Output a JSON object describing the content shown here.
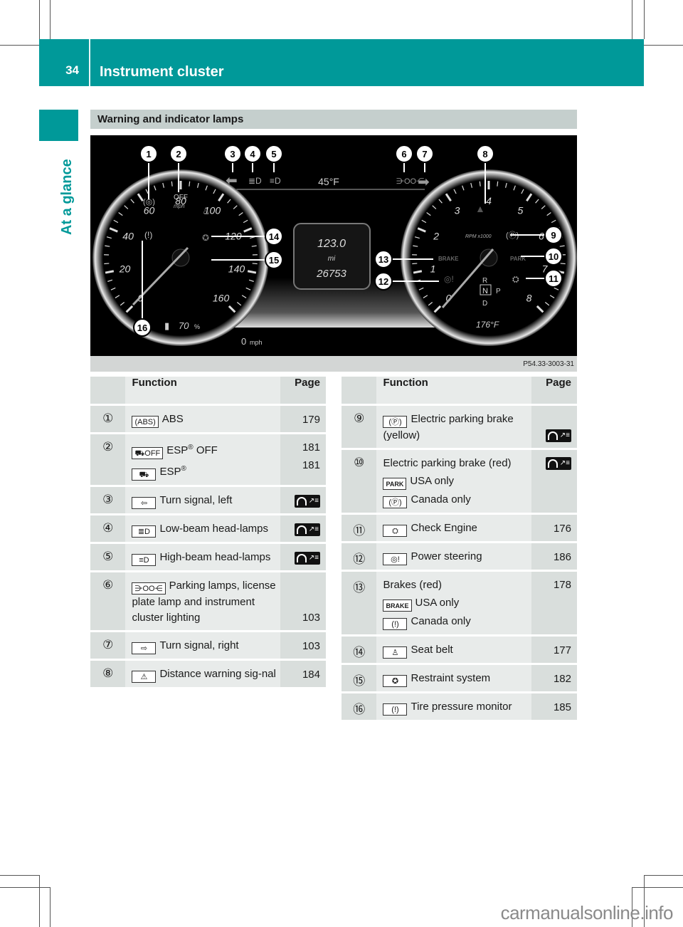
{
  "header": {
    "page_number": "34",
    "chapter_title": "Instrument cluster",
    "side_tab": "At a glance"
  },
  "section": {
    "title": "Warning and indicator lamps"
  },
  "figure": {
    "code": "P54.33-3003-31",
    "outside_temp": "45°F",
    "trip": "123.0",
    "unit": "mi",
    "odometer": "26753",
    "speed_readout": "0",
    "speed_unit": "mph",
    "fuel": "70",
    "fuel_unit": "%",
    "coolant": "176°F",
    "esp_off_label": "OFF",
    "mph_label": "mph",
    "rpm_label": "RPM x1000",
    "brake_label": "BRAKE",
    "park_label": "PARK",
    "gear_r": "R",
    "gear_n": "N",
    "gear_p": "P",
    "gear_d": "D",
    "speedo_ticks": [
      "0",
      "20",
      "40",
      "60",
      "80",
      "100",
      "120",
      "140",
      "160"
    ],
    "tacho_ticks": [
      "0",
      "1",
      "2",
      "3",
      "4",
      "5",
      "6",
      "7",
      "8"
    ],
    "callouts": [
      "1",
      "2",
      "3",
      "4",
      "5",
      "6",
      "7",
      "8",
      "9",
      "10",
      "11",
      "12",
      "13",
      "14",
      "15",
      "16"
    ]
  },
  "table_left": {
    "headers": {
      "function": "Function",
      "page": "Page"
    },
    "rows": [
      {
        "num": "1",
        "lines": [
          {
            "icon": "abs-icon",
            "icon_text": "(ABS)",
            "text": "ABS",
            "page": "179"
          }
        ]
      },
      {
        "num": "2",
        "lines": [
          {
            "icon": "esp-off-icon",
            "icon_text": "⛟OFF",
            "text": "ESP",
            "sup": "®",
            "text_after": " OFF",
            "page": "181"
          },
          {
            "icon": "esp-icon",
            "icon_text": "⛟",
            "text": "ESP",
            "sup": "®",
            "text_after": "",
            "page": "181"
          }
        ]
      },
      {
        "num": "3",
        "lines": [
          {
            "icon": "turn-left-icon",
            "icon_text": "⇦",
            "text": "Turn signal, left",
            "page_ref": "see-separate-manual-icon"
          }
        ]
      },
      {
        "num": "4",
        "lines": [
          {
            "icon": "low-beam-icon",
            "icon_text": "≣D",
            "text": "Low-beam head-lamps",
            "page_ref": "see-separate-manual-icon"
          }
        ]
      },
      {
        "num": "5",
        "lines": [
          {
            "icon": "high-beam-icon",
            "icon_text": "≡D",
            "text": "High-beam head-lamps",
            "page_ref": "see-separate-manual-icon"
          }
        ]
      },
      {
        "num": "6",
        "lines": [
          {
            "icon": "parking-lamps-icon",
            "icon_text": "⋺OO⋲",
            "text": "Parking lamps, license plate lamp and instrument cluster lighting",
            "page": "103"
          }
        ]
      },
      {
        "num": "7",
        "lines": [
          {
            "icon": "turn-right-icon",
            "icon_text": "⇨",
            "text": "Turn signal, right",
            "page": "103"
          }
        ]
      },
      {
        "num": "8",
        "lines": [
          {
            "icon": "distance-warning-icon",
            "icon_text": "⚠",
            "text": "Distance warning sig-nal",
            "page": "184"
          }
        ]
      }
    ]
  },
  "table_right": {
    "headers": {
      "function": "Function",
      "page": "Page"
    },
    "rows": [
      {
        "num": "9",
        "lines": [
          {
            "icon": "parking-brake-icon",
            "icon_text": "(Ⓟ)",
            "text": "Electric parking brake (yellow)",
            "page_ref": "see-separate-manual-icon"
          }
        ]
      },
      {
        "num": "10",
        "title": "Electric parking brake (red)",
        "page_ref": "see-separate-manual-icon",
        "lines": [
          {
            "icon": "park-text-icon",
            "icon_text": "PARK",
            "text": "USA only"
          },
          {
            "icon": "parking-brake-icon",
            "icon_text": "(Ⓟ)",
            "text": "Canada only"
          }
        ]
      },
      {
        "num": "11",
        "lines": [
          {
            "icon": "check-engine-icon",
            "icon_text": "⛭",
            "text": "Check Engine",
            "page": "176"
          }
        ]
      },
      {
        "num": "12",
        "lines": [
          {
            "icon": "power-steering-icon",
            "icon_text": "◎!",
            "text": "Power steering",
            "page": "186"
          }
        ]
      },
      {
        "num": "13",
        "title": "Brakes (red)",
        "page": "178",
        "lines": [
          {
            "icon": "brake-text-icon",
            "icon_text": "BRAKE",
            "text": "USA only"
          },
          {
            "icon": "brake-warning-icon",
            "icon_text": "(!)",
            "text": "Canada only"
          }
        ]
      },
      {
        "num": "14",
        "lines": [
          {
            "icon": "seat-belt-icon",
            "icon_text": "♙",
            "text": "Seat belt",
            "page": "177"
          }
        ]
      },
      {
        "num": "15",
        "lines": [
          {
            "icon": "restraint-system-icon",
            "icon_text": "✪",
            "text": "Restraint system",
            "page": "182"
          }
        ]
      },
      {
        "num": "16",
        "lines": [
          {
            "icon": "tire-pressure-icon",
            "icon_text": "(!)",
            "text": "Tire pressure monitor",
            "page": "185"
          }
        ]
      }
    ]
  },
  "footer": {
    "watermark": "carmanualsonline.info"
  },
  "colors": {
    "brand_teal": "#009999",
    "section_grey": "#c5cfcd",
    "table_light": "#e8ebea",
    "table_dark": "#d9dedc"
  }
}
